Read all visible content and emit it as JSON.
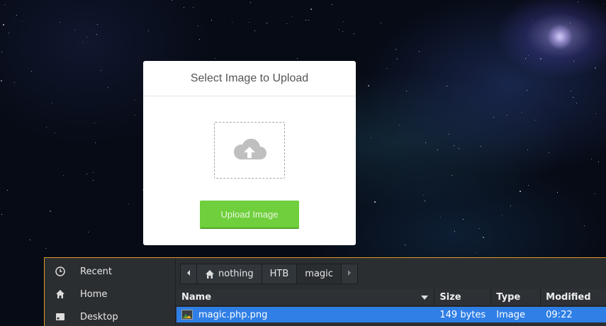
{
  "upload_modal": {
    "title": "Select Image to Upload",
    "dropzone_icon": "cloud-upload-icon",
    "button_label": "Upload Image"
  },
  "file_chooser": {
    "sidebar": [
      {
        "label": "Recent",
        "icon": "clock-icon"
      },
      {
        "label": "Home",
        "icon": "home-icon"
      },
      {
        "label": "Desktop",
        "icon": "desktop-icon"
      }
    ],
    "path": [
      "nothing",
      "HTB",
      "magic"
    ],
    "columns": {
      "name": "Name",
      "size": "Size",
      "type": "Type",
      "modified": "Modified"
    },
    "files": [
      {
        "name": "magic.php.png",
        "size": "149 bytes",
        "type": "Image",
        "modified": "09:22"
      }
    ]
  },
  "colors": {
    "upload_button": "#6fcf3c",
    "selection": "#2f7fe6",
    "chooser_border": "#d99a2b"
  }
}
